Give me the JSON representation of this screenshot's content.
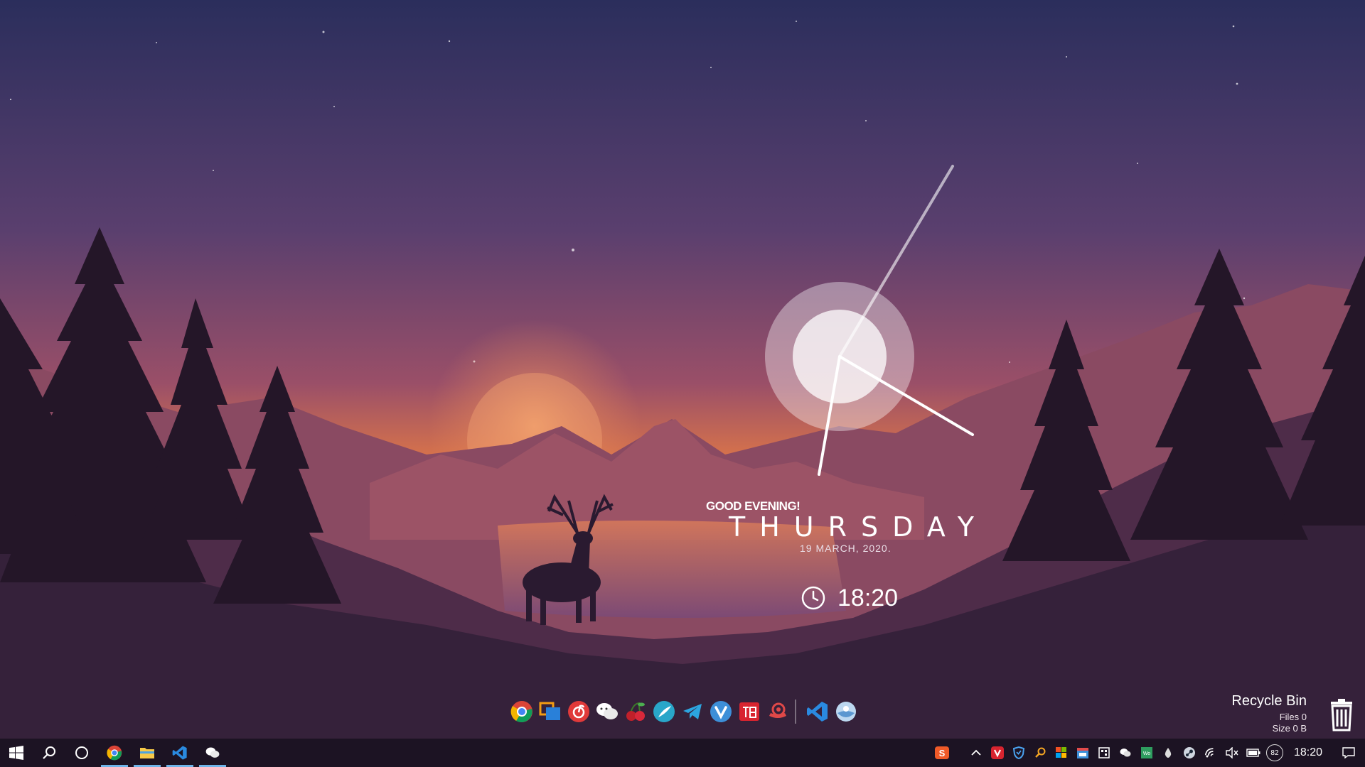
{
  "widget": {
    "greeting": "GOOD EVENING!",
    "day": "THURSDAY",
    "date": "19  MARCH,  2020.",
    "time": "18:20",
    "clock_face": {
      "hour": 18,
      "minute": 20
    }
  },
  "dock": {
    "icons": [
      "chrome-icon",
      "remote-desktop-icon",
      "netease-music-icon",
      "wechat-icon",
      "cherry-icon",
      "feather-browser-icon",
      "telegram-icon",
      "vivaldi-icon",
      "mail-icon",
      "snail-icon",
      "vscode-icon",
      "disk-cleaner-icon"
    ]
  },
  "recycle_bin": {
    "title": "Recycle Bin",
    "files": "Files 0",
    "size": "Size 0 B"
  },
  "taskbar": {
    "start_icon": "windows-icon",
    "search_icon": "search-icon",
    "cortana_icon": "cortana-icon",
    "pinned": [
      "chrome-icon",
      "file-explorer-icon",
      "vscode-icon",
      "wechat-icon"
    ],
    "tray_icons": [
      "sogou-input-icon",
      "show-hidden-icons-chevron",
      "vivaldi-tray-icon",
      "shield-icon",
      "search-tool-icon",
      "windows-store-icon",
      "calendar-icon",
      "qr-icon",
      "wechat-tray-icon",
      "word-icon",
      "drop-icon",
      "steam-icon",
      "wifi-icon",
      "volume-muted-icon",
      "battery-icon"
    ],
    "badge": "82",
    "clock": "18:20",
    "notification_icon": "notification-icon"
  },
  "colors": {
    "sky_top": "#2a2f5e",
    "sky_mid": "#7a4466",
    "horizon": "#e07a45",
    "mountain_far": "#8a4860",
    "mountain_near": "#4a2a45",
    "forest": "#2c1a30",
    "taskbar_accent": "#6fb4e8"
  }
}
